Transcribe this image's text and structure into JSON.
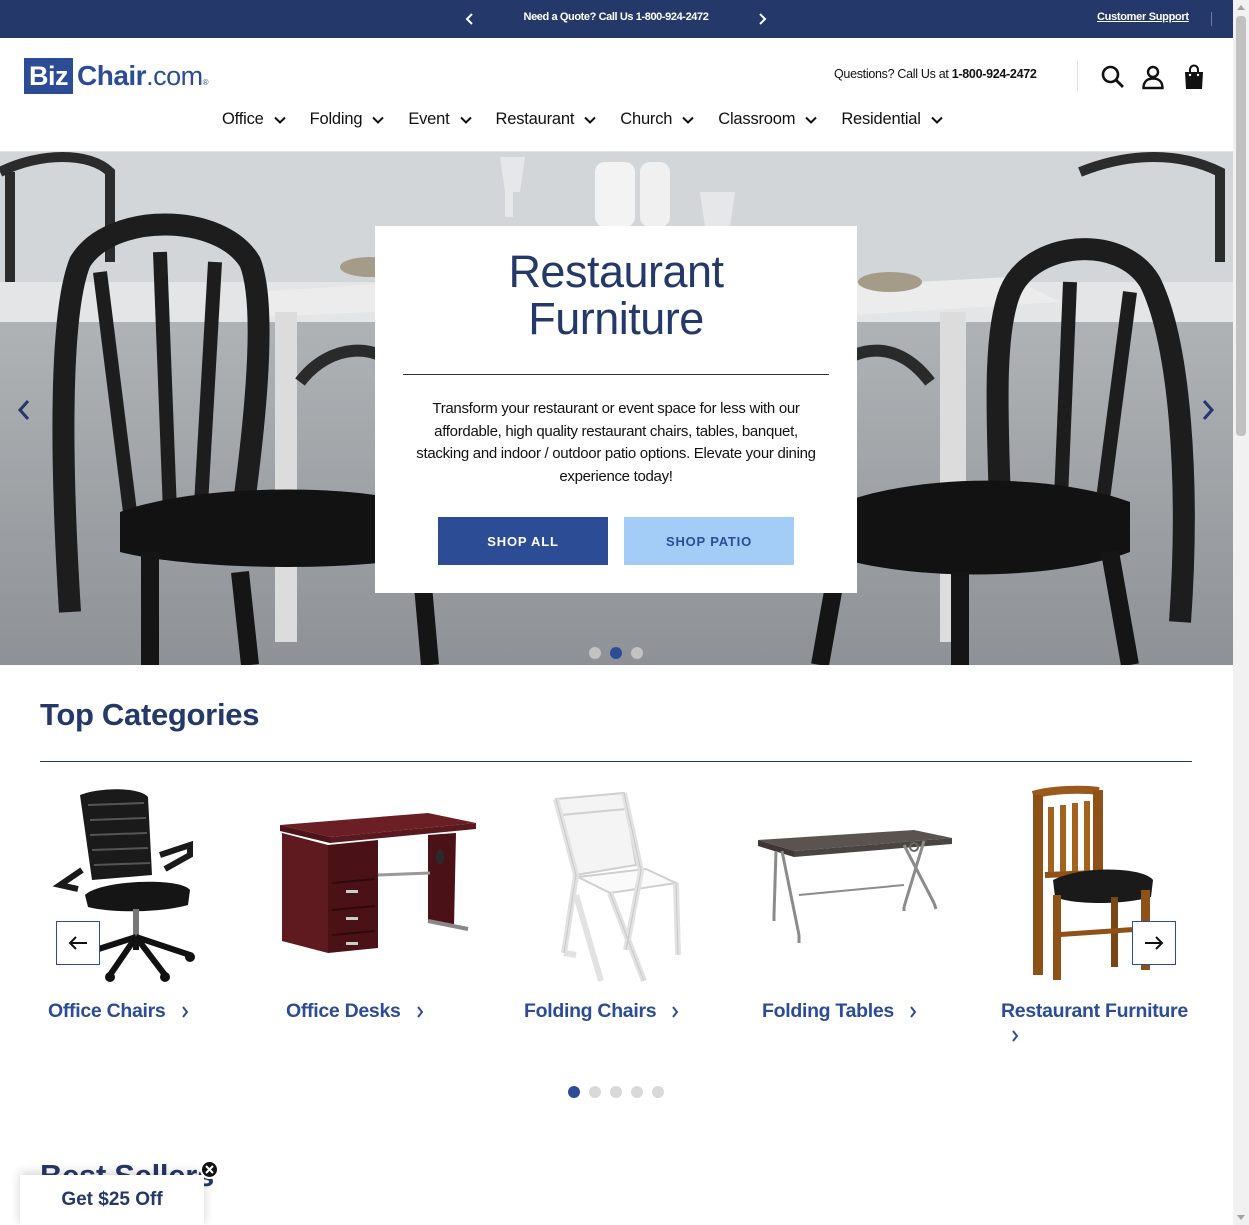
{
  "promo": {
    "message": "Need a Quote? Call Us 1-800-924-2472",
    "support_link": "Customer Support",
    "prev_icon": "chevron-left-icon",
    "next_icon": "chevron-right-icon"
  },
  "header": {
    "logo": {
      "biz": "Biz",
      "chair": "Chair",
      "dotcom": ".com",
      "reg": "®"
    },
    "questions_text": "Questions? Call Us at ",
    "phone": "1-800-924-2472",
    "icons": [
      "search-icon",
      "account-icon",
      "cart-icon"
    ]
  },
  "nav": [
    {
      "label": "Office"
    },
    {
      "label": "Folding"
    },
    {
      "label": "Event"
    },
    {
      "label": "Restaurant"
    },
    {
      "label": "Church"
    },
    {
      "label": "Classroom"
    },
    {
      "label": "Residential"
    }
  ],
  "hero": {
    "title_line1": "Restaurant",
    "title_line2": "Furniture",
    "description": "Transform your restaurant or event space for less with our affordable, high quality restaurant chairs, tables, banquet, stacking and indoor / outdoor patio options. Elevate your dining experience today!",
    "shop_all": "SHOP ALL",
    "shop_patio": "SHOP PATIO",
    "slides": 3,
    "active_slide": 2
  },
  "top_categories": {
    "title": "Top Categories",
    "items": [
      {
        "label": "Office Chairs"
      },
      {
        "label": "Office Desks"
      },
      {
        "label": "Folding Chairs"
      },
      {
        "label": "Folding Tables"
      },
      {
        "label": "Restaurant Furniture"
      }
    ],
    "pages": 5,
    "active_page": 1
  },
  "best_sellers": {
    "title": "Best Sellers"
  },
  "offer": {
    "label": "Get $25 Off"
  },
  "colors": {
    "brand_navy": "#24386a",
    "brand_blue": "#2c4c96",
    "light_blue": "#a3cdf6"
  }
}
